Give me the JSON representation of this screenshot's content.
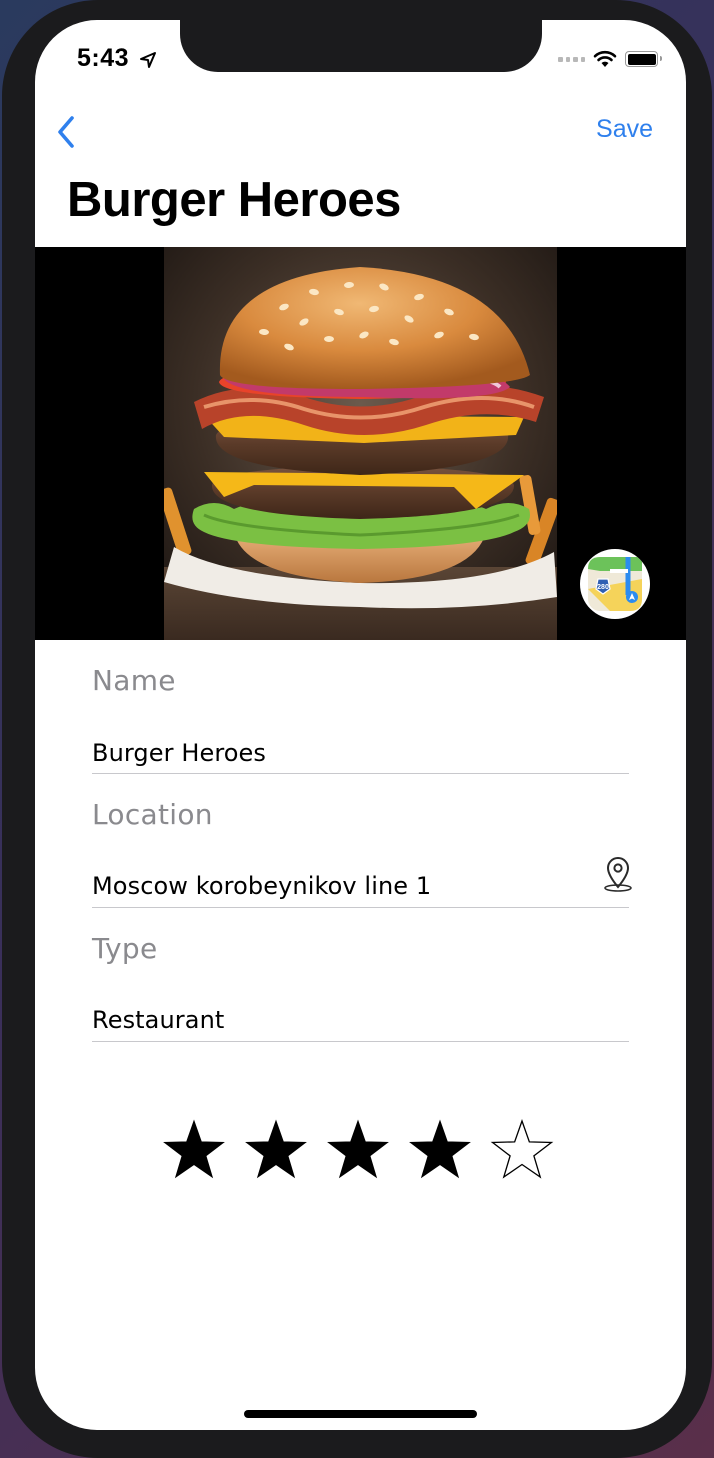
{
  "status_bar": {
    "time": "5:43"
  },
  "nav": {
    "back_icon": "chevron-left-icon",
    "save_label": "Save",
    "title": "Burger Heroes"
  },
  "hero": {
    "image": "burger-photo",
    "maps_icon": "apple-maps-icon",
    "maps_shield": "280"
  },
  "form": {
    "name": {
      "label": "Name",
      "value": "Burger Heroes"
    },
    "location": {
      "label": "Location",
      "value": "Moscow korobeynikov line 1",
      "icon": "location-pin-icon"
    },
    "type": {
      "label": "Type",
      "value": "Restaurant"
    }
  },
  "rating": {
    "value": 4,
    "max": 5
  },
  "colors": {
    "accent": "#2f80ed",
    "label_gray": "#8a8a8e",
    "divider": "#c8c8cc"
  }
}
